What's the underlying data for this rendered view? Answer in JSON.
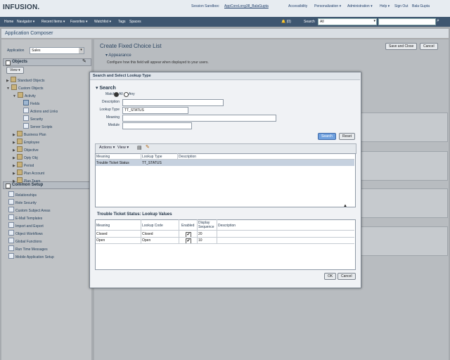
{
  "header": {
    "logo": "INFUSION.",
    "links": [
      "Session Sandbox:",
      "AppCoreLong38_BalaGupta",
      "Accessibility",
      "Personalization ▾",
      "Administration ▾",
      "Help ▾",
      "Sign Out",
      "Bala Gupta"
    ]
  },
  "nav": {
    "items": [
      "Home",
      "Navigator ▾",
      "Recent Items ▾",
      "Favorites ▾",
      "Watchlist ▾",
      "Tags",
      "Spaces"
    ],
    "notifications": "(0)",
    "search_label": "Search",
    "search_scope": "All"
  },
  "page": {
    "title": "Application Composer"
  },
  "left": {
    "app_label": "Application",
    "app_value": "Sales",
    "objects_header": "Objects",
    "view_btn": "View ▾",
    "tree": [
      {
        "label": "Standard Objects",
        "indent": 0,
        "icon": "folder",
        "exp": "▶"
      },
      {
        "label": "Custom Objects",
        "indent": 0,
        "icon": "folder",
        "exp": "▼"
      },
      {
        "label": "Activity",
        "indent": 1,
        "icon": "folder",
        "exp": "▼"
      },
      {
        "label": "Fields",
        "indent": 2,
        "icon": "fld",
        "exp": ""
      },
      {
        "label": "Actions and Links",
        "indent": 2,
        "icon": "doc",
        "exp": ""
      },
      {
        "label": "Security",
        "indent": 2,
        "icon": "doc",
        "exp": ""
      },
      {
        "label": "Server Scripts",
        "indent": 2,
        "icon": "doc",
        "exp": ""
      },
      {
        "label": "Business Plan",
        "indent": 1,
        "icon": "folder",
        "exp": "▶"
      },
      {
        "label": "Employee",
        "indent": 1,
        "icon": "folder",
        "exp": "▶"
      },
      {
        "label": "Objective",
        "indent": 1,
        "icon": "folder",
        "exp": "▶"
      },
      {
        "label": "Opty Obj",
        "indent": 1,
        "icon": "folder",
        "exp": "▶"
      },
      {
        "label": "Period",
        "indent": 1,
        "icon": "folder",
        "exp": "▶"
      },
      {
        "label": "Plan Account",
        "indent": 1,
        "icon": "folder",
        "exp": "▶"
      },
      {
        "label": "Plan Team",
        "indent": 1,
        "icon": "folder",
        "exp": "▶"
      }
    ],
    "common_header": "Common Setup",
    "common": [
      "Relationships",
      "Role Security",
      "Custom Subject Areas",
      "E-Mail Templates",
      "Import and Export",
      "Object Workflows",
      "Global Functions",
      "Run Time Messages",
      "Mobile Application Setup"
    ]
  },
  "right": {
    "title": "Create Fixed Choice List",
    "save_close": "Save and Close",
    "cancel": "Cancel",
    "appearance": "Appearance",
    "appearance_desc": "Configure how this field will appear when displayed to your users."
  },
  "dialog": {
    "title": "Search and Select Lookup Type",
    "search_header": "Search",
    "match_label": "Match",
    "match_all": "All",
    "match_any": "Any",
    "fields": [
      {
        "label": "Description",
        "value": "",
        "w": 140
      },
      {
        "label": "Lookup Type",
        "value": "TT_STATUS",
        "w": 90
      },
      {
        "label": "Meaning",
        "value": "",
        "w": 215
      },
      {
        "label": "Module",
        "value": "",
        "w": 95
      }
    ],
    "search_btn": "Search",
    "reset_btn": "Reset",
    "actions_btn": "Actions ▾",
    "view_btn": "View ▾",
    "results_columns": [
      "Meaning",
      "Lookup Type",
      "Description"
    ],
    "results_rows": [
      [
        "Trouble Ticket Status",
        "TT_STATUS",
        ""
      ]
    ],
    "values_title": "Trouble Ticket Status: Lookup Values",
    "values_columns": [
      "Meaning",
      "Lookup Code",
      "Enabled",
      "Display Sequence",
      "Description"
    ],
    "values_rows": [
      {
        "meaning": "Closed",
        "code": "Closed",
        "enabled": true,
        "seq": "20",
        "desc": ""
      },
      {
        "meaning": "Open",
        "code": "Open",
        "enabled": true,
        "seq": "10",
        "desc": ""
      }
    ],
    "ok_btn": "OK",
    "cancel_btn": "Cancel"
  }
}
